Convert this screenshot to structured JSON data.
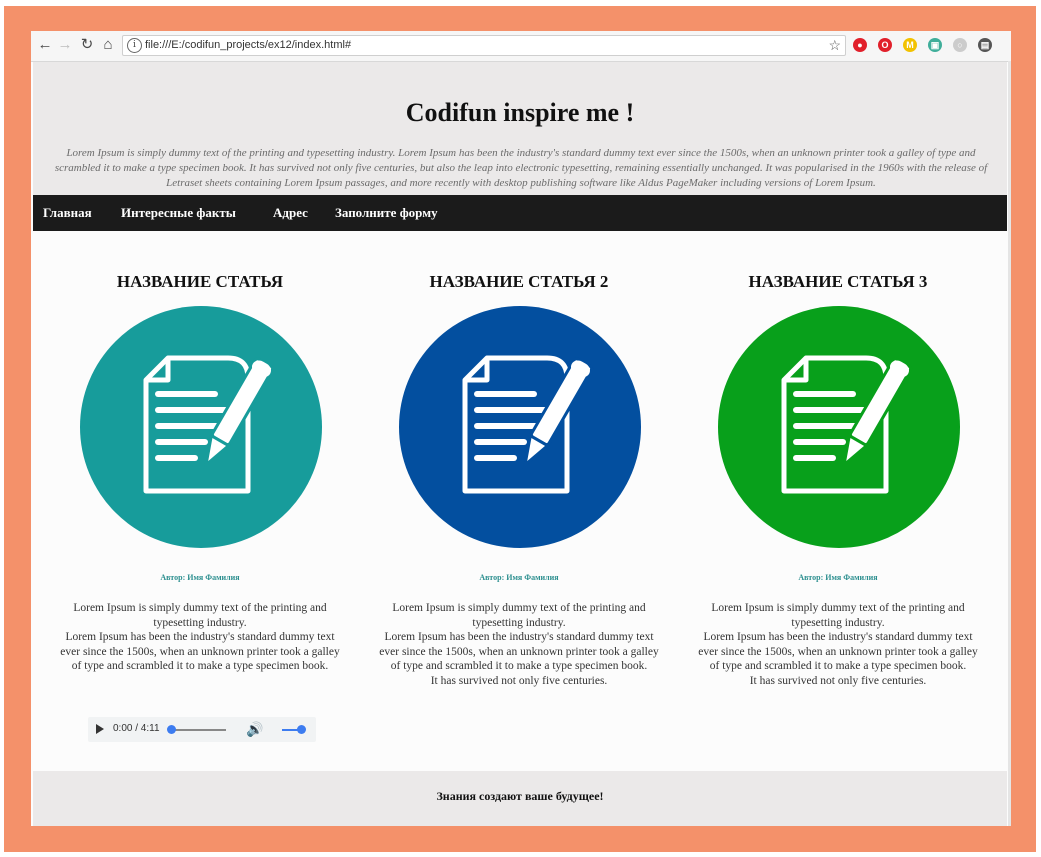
{
  "browser": {
    "url": "file:///E:/codifun_projects/ex12/index.html#",
    "extensions": [
      {
        "name": "opera-vpn-icon",
        "color": "#e1202b",
        "glyph": "●"
      },
      {
        "name": "opera-icon",
        "color": "#e1202b",
        "glyph": "O"
      },
      {
        "name": "m-extension-icon",
        "color": "#f2c200",
        "glyph": "M"
      },
      {
        "name": "green-extension-icon",
        "color": "#3fae9a",
        "glyph": "▣"
      },
      {
        "name": "gray-extension-icon",
        "color": "#cccccc",
        "glyph": "○"
      },
      {
        "name": "cast-icon",
        "color": "#555555",
        "glyph": "▤"
      }
    ]
  },
  "header": {
    "title": "Codifun inspire me !",
    "lorem": "Lorem Ipsum is simply dummy text of the printing and typesetting industry. Lorem Ipsum has been the industry's standard dummy text ever since the 1500s, when an unknown printer took a galley of type and scrambled it to make a type specimen book. It has survived not only five centuries, but also the leap into electronic typesetting, remaining essentially unchanged. It was popularised in the 1960s with the release of Letraset sheets containing Lorem Ipsum passages, and more recently with desktop publishing software like Aldus PageMaker including versions of Lorem Ipsum."
  },
  "menu": [
    {
      "label": "Главная"
    },
    {
      "label": "Интересные факты"
    },
    {
      "label": "Адрес"
    },
    {
      "label": "Заполните форму"
    }
  ],
  "articles": [
    {
      "title": "НАЗВАНИЕ СТАТЬЯ",
      "icon_color": "#179c9b",
      "author": "Автор: Имя Фамилия",
      "text_lines": [
        "Lorem Ipsum is simply dummy text of the printing and typesetting industry.",
        "Lorem Ipsum has been the industry's standard dummy text ever since the 1500s, when an unknown printer took a galley of type and scrambled it to make a type specimen book."
      ]
    },
    {
      "title": "НАЗВАНИЕ СТАТЬЯ 2",
      "icon_color": "#034f9f",
      "author": "Автор: Имя Фамилия",
      "text_lines": [
        "Lorem Ipsum is simply dummy text of the printing and typesetting industry.",
        "Lorem Ipsum has been the industry's standard dummy text ever since the 1500s, when an unknown printer took a galley of type and scrambled it to make a type specimen book.",
        "It has survived not only five centuries."
      ]
    },
    {
      "title": "НАЗВАНИЕ СТАТЬЯ 3",
      "icon_color": "#08a01b",
      "author": "Автор: Имя Фамилия",
      "text_lines": [
        "Lorem Ipsum is simply dummy text of the printing and typesetting industry.",
        "Lorem Ipsum has been the industry's standard dummy text ever since the 1500s, when an unknown printer took a galley of type and scrambled it to make a type specimen book.",
        "It has survived not only five centuries."
      ]
    }
  ],
  "audio": {
    "time": "0:00 / 4:11",
    "progress": 0,
    "volume": 1.0
  },
  "footer": {
    "text": "Знания создают ваше будущее!"
  },
  "colors": {
    "frame": "#f4916a",
    "menu_bg": "#1b1b1b",
    "header_bg": "#ebe9e9",
    "author": "#2c8f8f"
  }
}
